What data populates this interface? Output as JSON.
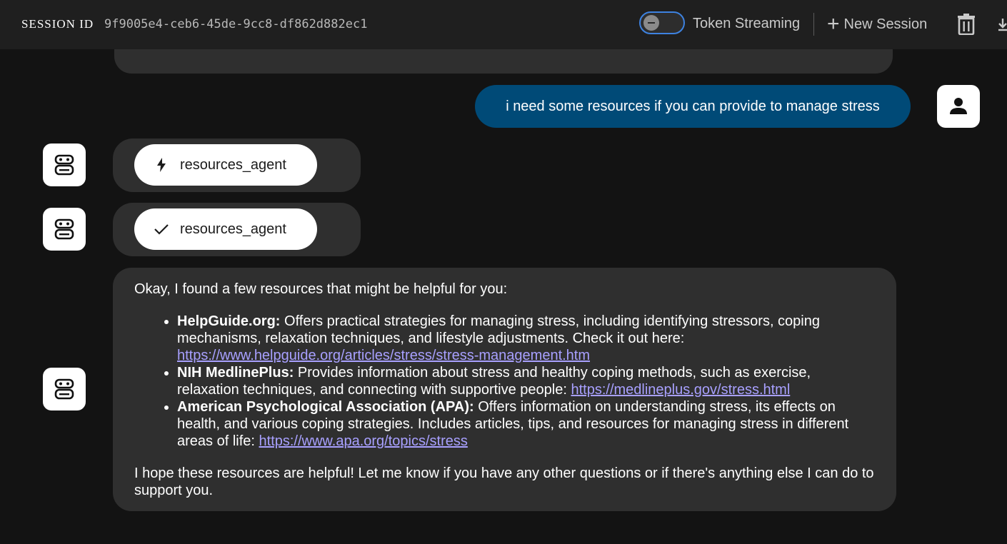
{
  "header": {
    "session_label": "SESSION ID",
    "session_id": "9f9005e4-ceb6-45de-9cc8-df862d882ec1",
    "toggle_label": "Token Streaming",
    "toggle_state": "off",
    "new_session_label": "New Session",
    "icons": [
      "toggle-knob-icon",
      "plus-icon",
      "trash-icon",
      "download-icon"
    ]
  },
  "chat": {
    "user_message": "i need some resources if you can provide to manage stress",
    "agent_events": [
      {
        "status": "running",
        "icon": "bolt-icon",
        "label": "resources_agent"
      },
      {
        "status": "done",
        "icon": "check-icon",
        "label": "resources_agent"
      }
    ],
    "response": {
      "intro": "Okay, I found a few resources that might be helpful for you:",
      "items": [
        {
          "title": "HelpGuide.org:",
          "text": " Offers practical strategies for managing stress, including identifying stressors, coping mechanisms, relaxation techniques, and lifestyle adjustments. Check it out here: ",
          "link": "https://www.helpguide.org/articles/stress/stress-management.htm"
        },
        {
          "title": "NIH MedlinePlus:",
          "text": " Provides information about stress and healthy coping methods, such as exercise, relaxation techniques, and connecting with supportive people: ",
          "link": "https://medlineplus.gov/stress.html"
        },
        {
          "title": "American Psychological Association (APA):",
          "text": " Offers information on understanding stress, its effects on health, and various coping strategies. Includes articles, tips, and resources for managing stress in different areas of life: ",
          "link": "https://www.apa.org/topics/stress"
        }
      ],
      "outro": "I hope these resources are helpful! Let me know if you have any other questions or if there's anything else I can do to support you."
    }
  },
  "colors": {
    "background": "#131313",
    "header": "#1f1f1f",
    "user_bubble": "#004a77",
    "agent_bubble": "#2f2f2f",
    "toggle_border": "#3d82e0",
    "link": "#a8a0ff"
  }
}
